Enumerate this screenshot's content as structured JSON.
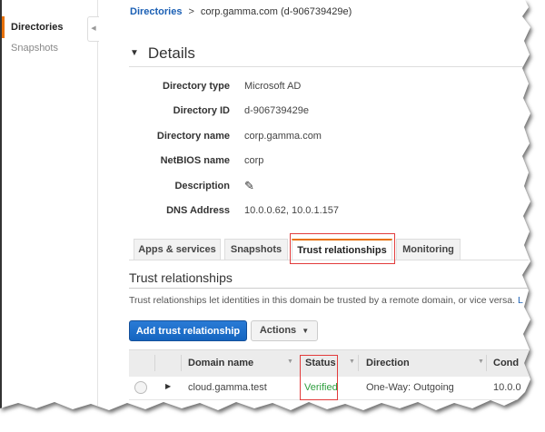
{
  "sidebar": {
    "items": [
      {
        "label": "Directories",
        "active": true
      },
      {
        "label": "Snapshots",
        "active": false
      }
    ],
    "collapse_icon": "chevron-left-icon"
  },
  "breadcrumb": {
    "link": "Directories",
    "separator": ">",
    "current": "corp.gamma.com (d-906739429e)"
  },
  "details": {
    "title": "Details",
    "rows": [
      {
        "label": "Directory type",
        "value": "Microsoft AD"
      },
      {
        "label": "Directory ID",
        "value": "d-906739429e"
      },
      {
        "label": "Directory name",
        "value": "corp.gamma.com"
      },
      {
        "label": "NetBIOS name",
        "value": "corp"
      },
      {
        "label": "Description",
        "value": "",
        "icon": "pencil-icon"
      },
      {
        "label": "DNS Address",
        "value": "10.0.0.62, 10.0.1.157"
      }
    ]
  },
  "tabs": [
    {
      "label": "Apps & services"
    },
    {
      "label": "Snapshots"
    },
    {
      "label": "Trust relationships",
      "active": true
    },
    {
      "label": "Monitoring"
    }
  ],
  "trust": {
    "title": "Trust relationships",
    "description": "Trust relationships let identities in this domain be trusted by a remote domain, or vice versa.",
    "learn_more": "L",
    "add_button": "Add trust relationship",
    "actions_button": "Actions",
    "columns": [
      "Domain name",
      "Status",
      "Direction",
      "Cond"
    ],
    "rows": [
      {
        "domain": "cloud.gamma.test",
        "status": "Verified",
        "direction": "One-Way: Outgoing",
        "cond": "10.0.0"
      }
    ]
  },
  "colors": {
    "accent": "#e8710a",
    "primary": "#1565c0",
    "verified": "#2e9e3e",
    "highlight": "#e23b3b"
  }
}
